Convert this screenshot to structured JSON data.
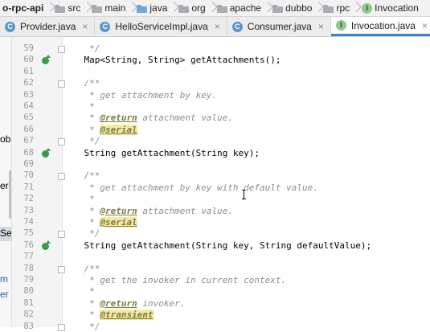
{
  "breadcrumb": {
    "items": [
      {
        "label": "o-rpc-api",
        "icon": null
      },
      {
        "label": "src",
        "icon": "folder-icon"
      },
      {
        "label": "main",
        "icon": "folder-icon"
      },
      {
        "label": "java",
        "icon": "source-folder-icon"
      },
      {
        "label": "org",
        "icon": "folder-icon"
      },
      {
        "label": "apache",
        "icon": "folder-icon"
      },
      {
        "label": "dubbo",
        "icon": "folder-icon"
      },
      {
        "label": "rpc",
        "icon": "folder-icon"
      },
      {
        "label": "Invocation",
        "icon": "interface-icon"
      }
    ]
  },
  "tabs": [
    {
      "label": "Provider.java",
      "icon": "class-icon",
      "active": false
    },
    {
      "label": "HelloServiceImpl.java",
      "icon": "class-icon",
      "active": false
    },
    {
      "label": "Consumer.java",
      "icon": "class-icon",
      "active": false
    },
    {
      "label": "Invocation.java",
      "icon": "interface-icon",
      "active": true
    }
  ],
  "left_panel": {
    "fragments": [
      "ob",
      "er",
      "Se",
      "m",
      "er"
    ]
  },
  "lines": [
    {
      "n": "59",
      "text": "     */"
    },
    {
      "n": "60",
      "text": "    Map<String, String> getAttachments();"
    },
    {
      "n": "61",
      "text": ""
    },
    {
      "n": "62",
      "text": "    /**"
    },
    {
      "n": "63",
      "text": "     * get attachment by key."
    },
    {
      "n": "64",
      "text": "     *"
    },
    {
      "n": "65",
      "text": "     * @return attachment value."
    },
    {
      "n": "66",
      "text": "     * @serial"
    },
    {
      "n": "67",
      "text": "     */"
    },
    {
      "n": "68",
      "text": "    String getAttachment(String key);"
    },
    {
      "n": "69",
      "text": ""
    },
    {
      "n": "70",
      "text": "    /**"
    },
    {
      "n": "71",
      "text": "     * get attachment by key with default value."
    },
    {
      "n": "72",
      "text": "     *"
    },
    {
      "n": "73",
      "text": "     * @return attachment value."
    },
    {
      "n": "74",
      "text": "     * @serial"
    },
    {
      "n": "75",
      "text": "     */"
    },
    {
      "n": "76",
      "text": "    String getAttachment(String key, String defaultValue);"
    },
    {
      "n": "77",
      "text": ""
    },
    {
      "n": "78",
      "text": "    /**"
    },
    {
      "n": "79",
      "text": "     * get the invoker in current context."
    },
    {
      "n": "80",
      "text": "     *"
    },
    {
      "n": "81",
      "text": "     * @return invoker."
    },
    {
      "n": "82",
      "text": "     * @transient"
    },
    {
      "n": "83",
      "text": "     */"
    }
  ],
  "colors": {
    "tab_active_underline": "#4083c9",
    "doc_comment": "#8c8c8c",
    "doc_tag": "#7a7a43",
    "implemented_marker": "#3a9a4a"
  }
}
